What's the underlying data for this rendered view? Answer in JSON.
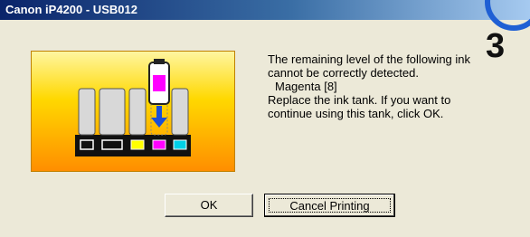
{
  "window": {
    "title": "Canon iP4200 - USB012"
  },
  "step_number": "3",
  "message": {
    "line1": "The remaining level of the following ink",
    "line2": "cannot be correctly detected.",
    "ink_name": "Magenta [8]",
    "line4": "Replace the ink tank. If you want to",
    "line5": "continue using this tank, click OK."
  },
  "buttons": {
    "ok": "OK",
    "cancel": "Cancel Printing"
  },
  "colors": {
    "titlebar_start": "#0a246a",
    "dialog_bg": "#ece9d8",
    "magenta": "#ff00ff",
    "cyan": "#00d0e8",
    "yellow": "#ffff00",
    "arrow": "#1a4fd8"
  },
  "icons": [
    "ink-cartridge-icon",
    "down-arrow-icon"
  ]
}
